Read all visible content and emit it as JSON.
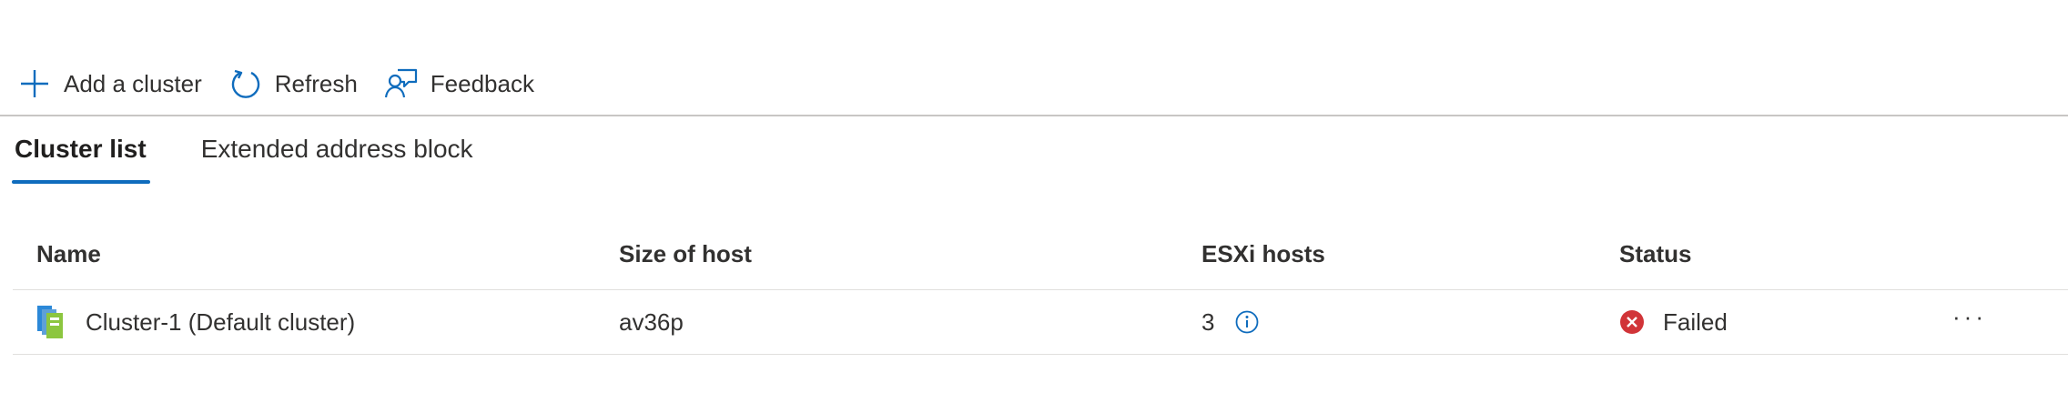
{
  "toolbar": {
    "add_label": "Add a cluster",
    "refresh_label": "Refresh",
    "feedback_label": "Feedback"
  },
  "tabs": [
    {
      "label": "Cluster list",
      "active": true
    },
    {
      "label": "Extended address block",
      "active": false
    }
  ],
  "table": {
    "columns": [
      "Name",
      "Size of host",
      "ESXi hosts",
      "Status"
    ],
    "rows": [
      {
        "name": "Cluster-1 (Default cluster)",
        "size": "av36p",
        "hosts": "3",
        "status": "Failed",
        "more": "···"
      }
    ]
  },
  "colors": {
    "accent": "#0f6cbd",
    "error": "#d13438",
    "divider": "#c8c6c4",
    "row_border": "#e1dfdd",
    "cluster_icon_blue": "#2b88d8",
    "cluster_icon_green": "#8cc63f"
  },
  "icons": {
    "add": "add-icon",
    "refresh": "refresh-icon",
    "feedback": "feedback-icon",
    "cluster": "cluster-icon",
    "info": "info-icon",
    "status": "error-circle-icon",
    "more": "more-icon"
  }
}
